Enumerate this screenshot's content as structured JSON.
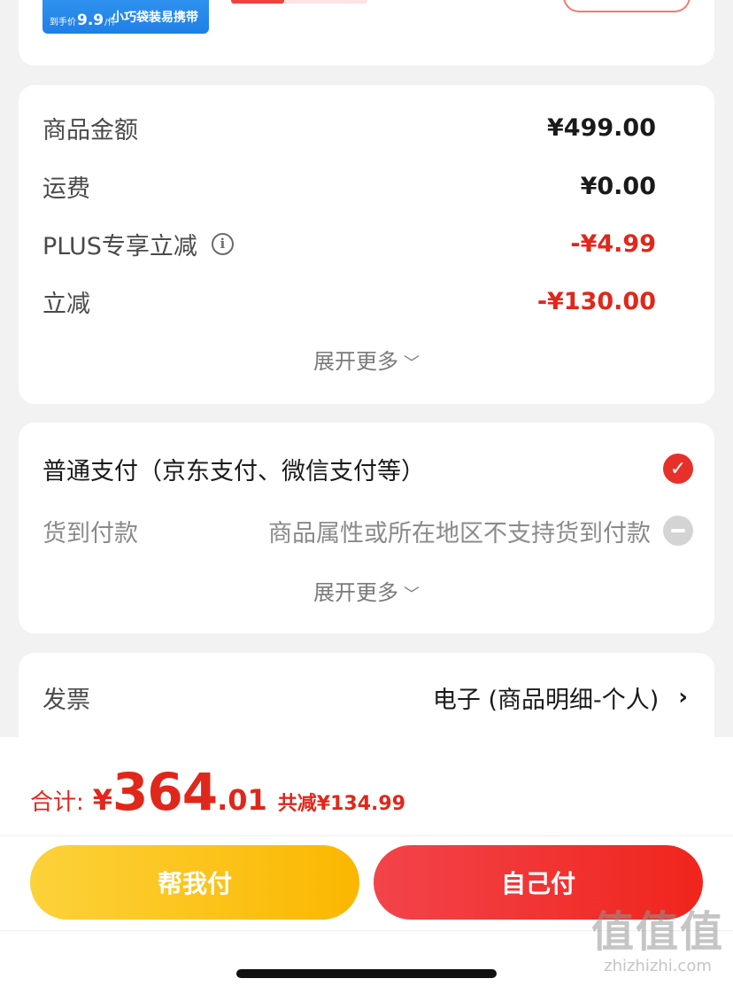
{
  "product": {
    "promo_price_prefix": "到手价",
    "promo_price": "9.9",
    "promo_unit": "/件",
    "promo_tag": "小巧袋装易携带"
  },
  "amount": {
    "rows": [
      {
        "label": "商品金额",
        "value": "¥499.00"
      },
      {
        "label": "运费",
        "value": "¥0.00"
      },
      {
        "label": "PLUS专享立减",
        "value": "-¥4.99"
      },
      {
        "label": "立减",
        "value": "-¥130.00"
      }
    ],
    "expand_label": "展开更多"
  },
  "payment": {
    "normal_label": "普通支付（京东支付、微信支付等）",
    "cod_label": "货到付款",
    "cod_note": "商品属性或所在地区不支持货到付款",
    "expand_label": "展开更多"
  },
  "invoice": {
    "label": "发票",
    "value": "电子 (商品明细-个人)"
  },
  "total": {
    "label": "合计:",
    "yen": "¥",
    "integer": "364",
    "decimal": ".01",
    "saved": "共减¥134.99"
  },
  "buttons": {
    "help_pay": "帮我付",
    "self_pay": "自己付"
  },
  "watermark": {
    "logo": "值值值",
    "url": "zhizhizhi.com"
  },
  "colors": {
    "accent_red": "#e0271b",
    "yellow": "#fbb700",
    "background": "#f2f2f2"
  }
}
